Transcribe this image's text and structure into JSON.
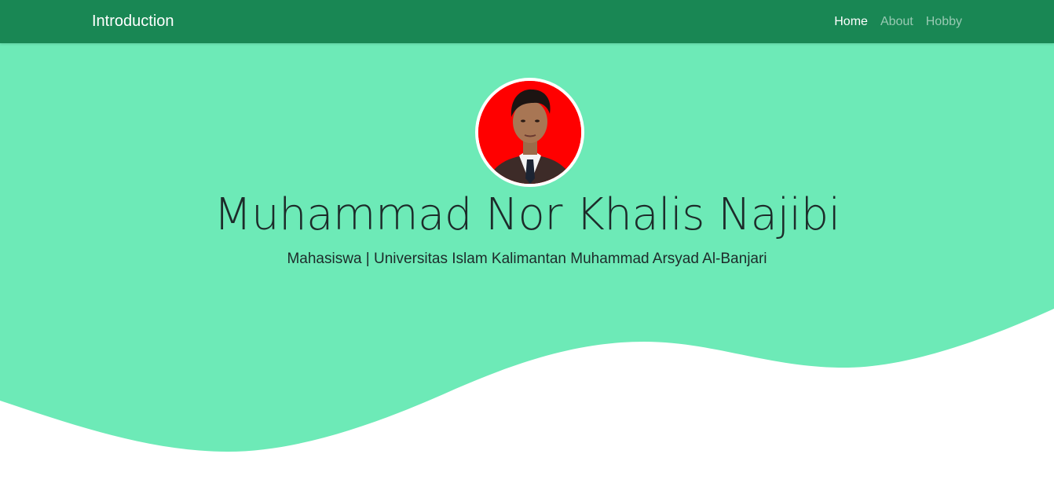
{
  "navbar": {
    "brand": "Introduction",
    "links": [
      {
        "label": "Home",
        "active": true
      },
      {
        "label": "About",
        "active": false
      },
      {
        "label": "Hobby",
        "active": false
      }
    ]
  },
  "hero": {
    "name": "Muhammad Nor Khalis Najibi",
    "subtitle": "Mahasiswa | Universitas Islam Kalimantan Muhammad Arsyad Al-Banjari"
  },
  "colors": {
    "navbar_bg": "#198754",
    "hero_bg": "#6deab7",
    "avatar_bg": "#ff0000"
  }
}
